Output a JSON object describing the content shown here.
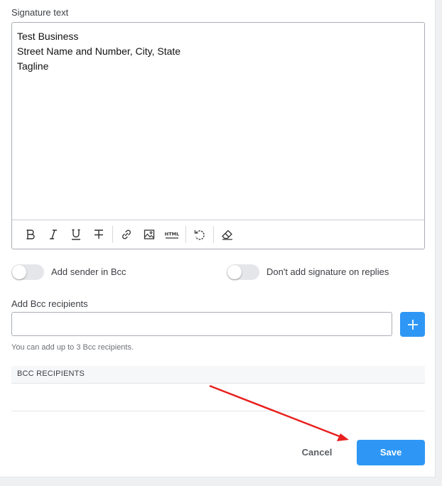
{
  "signature": {
    "label": "Signature text",
    "lines": [
      "Test Business",
      "Street Name and Number, City, State",
      "Tagline"
    ]
  },
  "toolbar": {
    "items": [
      "bold-icon",
      "italic-icon",
      "underline-icon",
      "strikethrough-icon",
      "link-icon",
      "image-icon",
      "html-icon",
      "undo-icon",
      "eraser-icon"
    ]
  },
  "toggles": {
    "add_sender_bcc": "Add sender in Bcc",
    "no_signature_replies": "Don't add signature on replies"
  },
  "bcc": {
    "label": "Add Bcc recipients",
    "input_value": "",
    "hint": "You can add up to 3 Bcc recipients.",
    "list_header": "BCC RECIPIENTS"
  },
  "actions": {
    "cancel": "Cancel",
    "save": "Save"
  },
  "colors": {
    "accent": "#2e97f5",
    "annotation_arrow": "#e8201f"
  }
}
